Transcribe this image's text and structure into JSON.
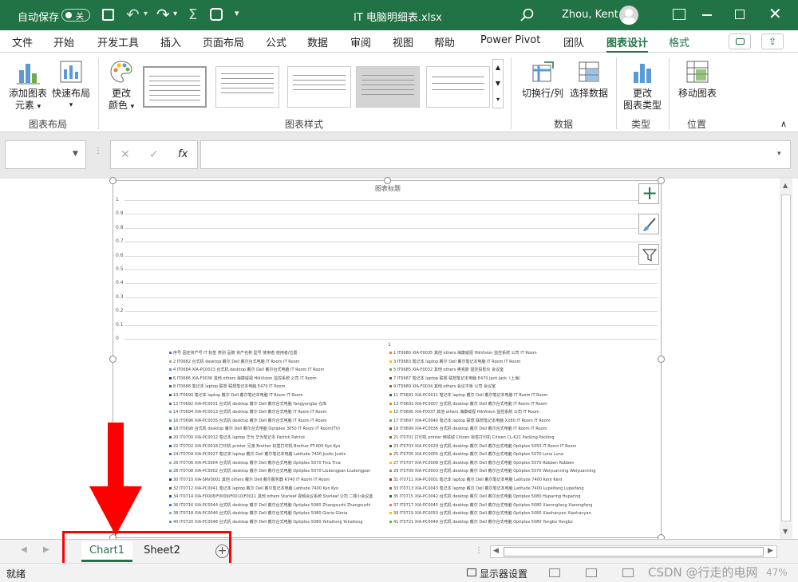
{
  "titlebar": {
    "autosave_label": "自动保存",
    "autosave_state": "关",
    "file_title": "IT 电脑明细表.xlsx",
    "user_name": "Zhou, Kent"
  },
  "ribbon_tabs": [
    "文件",
    "开始",
    "开发工具",
    "插入",
    "页面布局",
    "公式",
    "数据",
    "审阅",
    "视图",
    "帮助",
    "Power Pivot",
    "团队",
    "图表设计",
    "格式"
  ],
  "ribbon": {
    "add_chart_element": [
      "添加图表",
      "元素"
    ],
    "quick_layout": "快速布局",
    "group_chart_layout": "图表布局",
    "change_colors": [
      "更改",
      "颜色"
    ],
    "group_chart_styles": "图表样式",
    "switch_row_col": "切换行/列",
    "select_data": "选择数据",
    "group_data": "数据",
    "change_chart_type": [
      "更改",
      "图表类型"
    ],
    "group_type": "类型",
    "move_chart": "移动图表",
    "group_location": "位置"
  },
  "formula_bar": {
    "name_box": "",
    "fx": "fx",
    "formula": ""
  },
  "chart_data": {
    "type": "bar",
    "title": "图表标题",
    "categories": [
      "1"
    ],
    "ylim": [
      0,
      1
    ],
    "yticks": [
      "1",
      "0.9",
      "0.8",
      "0.7",
      "0.6",
      "0.5",
      "0.4",
      "0.3",
      "0.2",
      "0.1",
      "0"
    ],
    "grid": true,
    "legend_position": "bottom",
    "legend": [
      "序号 固定资产号 IT 标签 类别 品牌 资产名称 型号 使用者 使用者/位置",
      "1 IT0680 XIA-F0035 其他 others 海康威视 HikVision 监控系统 公司 IT Room",
      "2 IT0682 台式机 desktop 戴尔 Dell 戴尔台式电脑 IT Room IT Room",
      "3 IT0683 笔记本 laptop 戴尔 Dell 戴尔笔记本电脑 IT Room IT Room",
      "4 IT0684 XIA-PC0023 台式机 desktop 戴尔 Dell 戴尔台式电脑 IT Room IT Room",
      "5 IT0685 XIA-F0032 其他 others 奥克斯 固定投影仪 会议室",
      "6 IT0686 XIA-F0036 其他 others 海康威视 HikVision 监控系统 公司 IT Room",
      "7 IT0687 笔记本 laptop 联想 联想笔记本电脑 E470 Jack Jack（上海）",
      "8 IT0688 笔记本 laptop 联想 联想笔记本电脑 E470 IT Room",
      "9 IT0689 XIA-F0034 其他 others 会议平板 公司 会议室",
      "10 IT0690 笔记本 laptop 戴尔 Dell 戴尔笔记本电脑 IT Room IT Room",
      "11 IT0691 XIA-PC0011 笔记本 laptop 戴尔 Dell 戴尔笔记本电脑 IT Room IT Room",
      "12 IT0692 XIA-PC0031 台式机 desktop 戴尔 Dell 戴尔台式电脑 Yangyongbo 仓库",
      "13 IT0693 XIA-PC0007 台式机 desktop 戴尔 Dell 戴尔台式电脑 IT Room IT Room",
      "14 IT0694 XIA-PC0013 台式机 desktop 戴尔 Dell 戴尔台式电脑 IT Room IT Room",
      "15 IT0695 XIA-F0037 其他 others 海康威视 HikVision 监控系统 公司 IT Room",
      "16 IT0696 XIA-PC0035 台式机 desktop 戴尔 Dell 戴尔台式电脑 IT Room IT Room",
      "17 IT0697 XIA-PC0040 笔记本 laptop 联想 联想笔记本电脑 X280 IT Room IT Room",
      "18 IT0698 台式机 desktop 戴尔 Dell 戴尔台式电脑 Optiplex 3050 IT Room IT Room(TV)",
      "19 IT0699 XIA-PC0036 台式机 desktop 戴尔 Dell 戴尔台式电脑 IT Room IT Room",
      "20 IT0700 XIA-PC0012 笔记本 laptop 华为 华为笔记本 Patrick Patrick",
      "21 IT0701 打印机 printer 西铁城 Citizen 标签打印机 Citizen CL-621 Packing Packing",
      "22 IT0702 XIA-PC0018 打印机 printer 兄弟 Brother 标签打印机 Brother PT-600 Kyo Kyo",
      "23 IT0703 XIA-PC0029 台式机 desktop 戴尔 Dell 戴尔台式电脑 Optiplex 5050 IT Room IT Room",
      "24 IT0704 XIA-PC0027 笔记本 laptop 戴尔 Dell 戴尔笔记本电脑 Latitude 7400 Justin Justin",
      "25 IT0705 XIA-PC0005 台式机 desktop 戴尔 Dell 戴尔台式电脑 Optiplex 5070 Luna Luna",
      "26 IT0706 XIA-PC0004 台式机 desktop 戴尔 Dell 戴尔台式电脑 Optiplex 5070 Tina Tina",
      "27 IT0707 XIA-PC0008 台式机 desktop 戴尔 Dell 戴尔台式电脑 Optiplex 5070 Robben Robben",
      "28 IT0708 XIA-PC0002 台式机 desktop 戴尔 Dell 戴尔台式电脑 Optiplex 5070 Liudongpan Liudongpan",
      "29 IT0709 XIA-PC0003 台式机 desktop 戴尔 Dell 戴尔台式电脑 Optiplex 5070 Weiyuanning Weiyuanning",
      "30 IT0710 XIA-SRV0001 其他 others 戴尔 Dell 戴尔服务器 R740 IT Room IT Room",
      "31 IT0711 XIA-PC0001 笔记本 laptop 戴尔 Dell 戴尔笔记本电脑 Latitude 7400 Kent Kent",
      "32 IT0712 XIA-PC0041 笔记本 laptop 戴尔 Dell 戴尔笔记本电脑 Latitude 7400 Kyo Kyo",
      "33 IT0713 XIA-PC0043 笔记本 laptop 戴尔 Dell 戴尔笔记本电脑 Latitude 7400 Lupeifang Lupeifang",
      "34 IT0714 XIA-F0008/F0009/F0010/F0011 其他 others Starleaf 视频会议系统 Starleaf 公司 二楼小会议室",
      "35 IT0715 XIA-PC0042 台式机 desktop 戴尔 Dell 戴尔台式电脑 Optiplex 5080 Huparing Huparing",
      "36 IT0716 XIA-PC0044 台式机 desktop 戴尔 Dell 戴尔台式电脑 Optiplex 5080 Zhangxuzhi Zhangxuzhi",
      "37 IT0717 XIA-PC0045 台式机 desktop 戴尔 Dell 戴尔台式电脑 Optiplex 5080 Xiarongfang Xiarongfang",
      "38 IT0718 XIA-PC0046 台式机 desktop 戴尔 Dell 戴尔台式电脑 Optiplex 5080 Gloria Gloria",
      "39 IT0719 XIA-PC0050 台式机 desktop 戴尔 Dell 戴尔台式电脑 Optiplex 5080 Xiaohanyan Xiaohanyan",
      "40 IT0720 XIA-PC0048 台式机 desktop 戴尔 Dell 戴尔台式电脑 Optiplex 5080 Yehaitong Yehaitong",
      "41 IT0721 XIA-PC0049 台式机 desktop 戴尔 Dell 戴尔台式电脑 Optiplex 5080 Yongbo Yongbo"
    ],
    "legend_colors": [
      "#4472c4",
      "#ed7d31",
      "#a5a5a5",
      "#ffc000",
      "#5b9bd5",
      "#70ad47",
      "#264478",
      "#9e480e",
      "#636363",
      "#997300",
      "#255e91",
      "#43682b"
    ]
  },
  "sheet_tabs": [
    {
      "label": "Chart1",
      "active": true
    },
    {
      "label": "Sheet2",
      "active": false
    }
  ],
  "statusbar": {
    "ready": "就绪",
    "display_settings": "显示器设置",
    "zoom": "47%"
  },
  "watermark": "CSDN @行走的电网",
  "colors": {
    "accent": "#217346",
    "annotation": "#ff0000"
  }
}
